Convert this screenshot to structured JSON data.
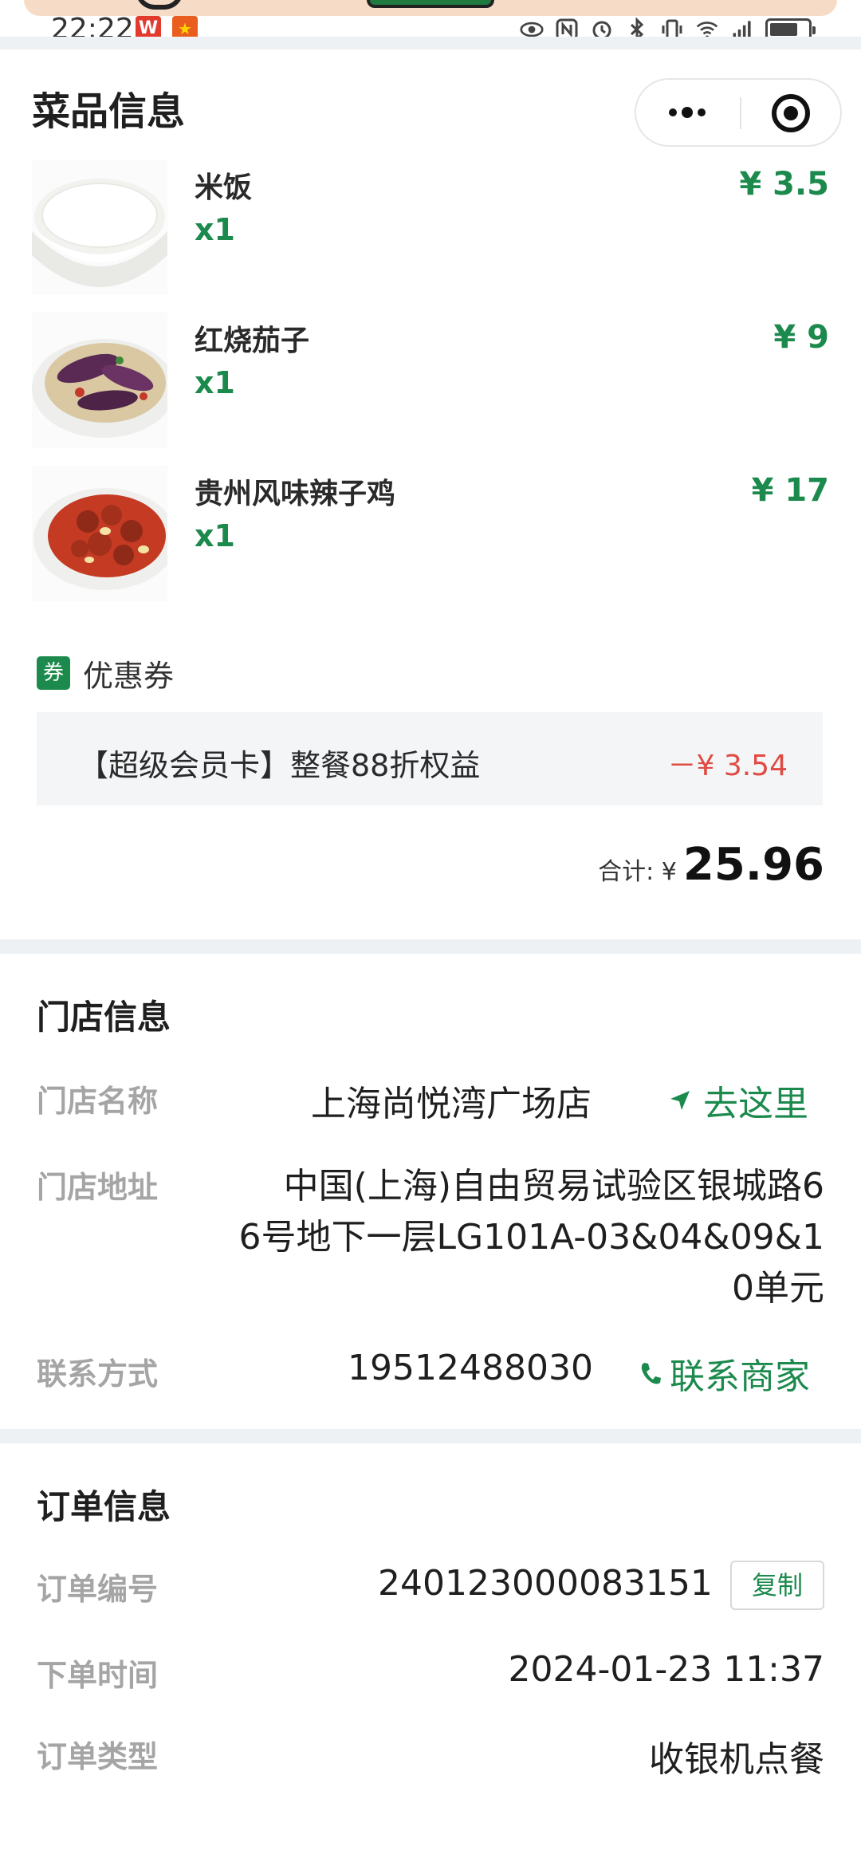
{
  "status_bar": {
    "time": "22:22",
    "badge_w": "W",
    "badge_star": "★"
  },
  "header": {
    "title": "菜品信息"
  },
  "dishes": [
    {
      "name": "米饭",
      "qty": "x1",
      "price": "¥ 3.5"
    },
    {
      "name": "红烧茄子",
      "qty": "x1",
      "price": "¥ 9"
    },
    {
      "name": "贵州风味辣子鸡",
      "qty": "x1",
      "price": "¥ 17"
    }
  ],
  "coupon": {
    "badge": "券",
    "title": "优惠券",
    "name": "【超级会员卡】整餐88折权益",
    "amount": "－¥ 3.54"
  },
  "total": {
    "label": "合计: ¥",
    "value": "25.96"
  },
  "store": {
    "section_title": "门店信息",
    "name_label": "门店名称",
    "name": "上海尚悦湾广场店",
    "goto_label": "去这里",
    "address_label": "门店地址",
    "address_line1": "中国(上海)自由贸易试验区银城路6",
    "address_line2": "6号地下一层LG101A-03&04&09&1",
    "address_line3": "0单元",
    "contact_label": "联系方式",
    "phone": "19512488030",
    "contact_action": "联系商家"
  },
  "order": {
    "section_title": "订单信息",
    "number_label": "订单编号",
    "number": "240123000083151",
    "copy_label": "复制",
    "time_label": "下单时间",
    "time": "2024-01-23 11:37",
    "type_label": "订单类型",
    "type": "收银机点餐"
  },
  "colors": {
    "accent_green": "#1b8a4c",
    "discount_red": "#e04a43",
    "label_gray": "#a5a5a5"
  }
}
